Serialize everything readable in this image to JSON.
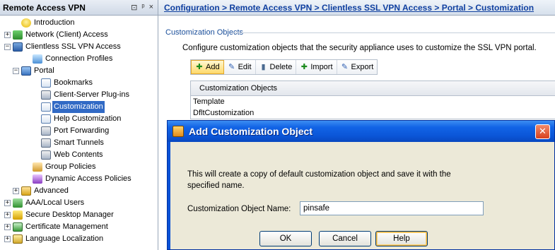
{
  "left_pane": {
    "title": "Remote Access VPN",
    "controls": [
      "⊡",
      "ᵖ",
      "×"
    ]
  },
  "tree": [
    {
      "label": "Introduction",
      "level": 1,
      "icon": "help",
      "expander": ""
    },
    {
      "label": "Network (Client) Access",
      "level": 0,
      "icon": "net",
      "expander": "+"
    },
    {
      "label": "Clientless SSL VPN Access",
      "level": 0,
      "icon": "ssl",
      "expander": "−"
    },
    {
      "label": "Connection Profiles",
      "level": 2,
      "icon": "profile",
      "expander": ""
    },
    {
      "label": "Portal",
      "level": 1,
      "icon": "portal",
      "expander": "−"
    },
    {
      "label": "Bookmarks",
      "level": 3,
      "icon": "doc",
      "expander": ""
    },
    {
      "label": "Client-Server Plug-ins",
      "level": 3,
      "icon": "plug",
      "expander": ""
    },
    {
      "label": "Customization",
      "level": 3,
      "icon": "doc",
      "expander": "",
      "selected": true
    },
    {
      "label": "Help Customization",
      "level": 3,
      "icon": "doc",
      "expander": ""
    },
    {
      "label": "Port Forwarding",
      "level": 3,
      "icon": "plug",
      "expander": ""
    },
    {
      "label": "Smart Tunnels",
      "level": 3,
      "icon": "plug",
      "expander": ""
    },
    {
      "label": "Web Contents",
      "level": 3,
      "icon": "plug",
      "expander": ""
    },
    {
      "label": "Group Policies",
      "level": 2,
      "icon": "group",
      "expander": ""
    },
    {
      "label": "Dynamic Access Policies",
      "level": 2,
      "icon": "dap",
      "expander": ""
    },
    {
      "label": "Advanced",
      "level": 1,
      "icon": "adv",
      "expander": "+"
    },
    {
      "label": "AAA/Local Users",
      "level": 0,
      "icon": "aaa",
      "expander": "+"
    },
    {
      "label": "Secure Desktop Manager",
      "level": 0,
      "icon": "sdm",
      "expander": "+"
    },
    {
      "label": "Certificate Management",
      "level": 0,
      "icon": "cert",
      "expander": "+"
    },
    {
      "label": "Language Localization",
      "level": 0,
      "icon": "lang",
      "expander": "+"
    }
  ],
  "breadcrumb": "Configuration > Remote Access VPN > Clientless SSL VPN Access > Portal > Customization",
  "group": {
    "title": "Customization Objects",
    "description": "Configure customization objects that the security appliance uses to customize the SSL VPN portal."
  },
  "toolbar": {
    "add": "Add",
    "edit": "Edit",
    "delete": "Delete",
    "import": "Import",
    "export": "Export"
  },
  "table": {
    "header": "Customization Objects",
    "rows": [
      "Template",
      "DfltCustomization"
    ]
  },
  "dialog": {
    "title": "Add Customization Object",
    "message": "This will create a copy of default customization object and save it with the specified name.",
    "name_label": "Customization Object Name:",
    "name_value": "pinsafe",
    "ok": "OK",
    "cancel": "Cancel",
    "help": "Help"
  }
}
